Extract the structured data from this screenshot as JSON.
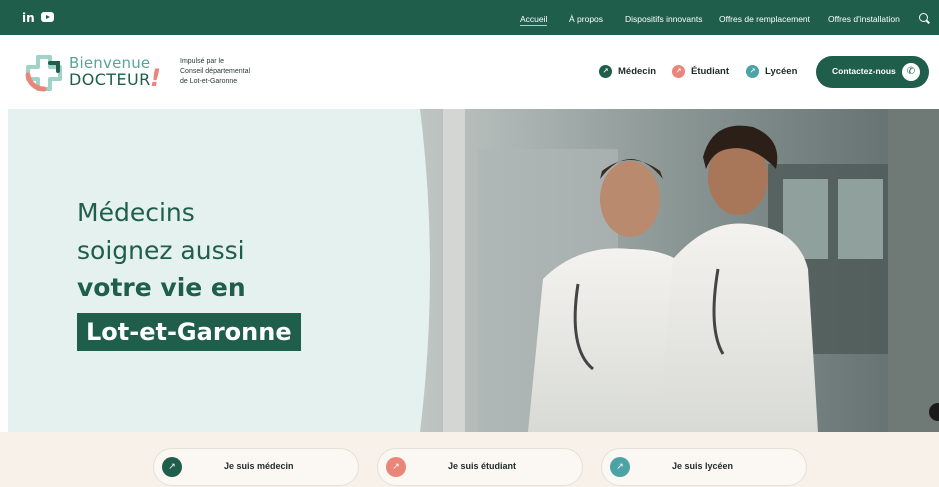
{
  "topbar": {
    "social": {
      "linkedin": "in",
      "youtube_icon": "youtube-icon"
    },
    "nav": [
      {
        "label": "Accueil",
        "active": true
      },
      {
        "label": "À propos"
      },
      {
        "label": "Dispositifs innovants"
      },
      {
        "label": "Offres de remplacement"
      },
      {
        "label": "Offres d'installation"
      }
    ],
    "search_icon": "search-icon"
  },
  "header": {
    "logo": {
      "line1": "Bienvenue",
      "line2": "DOCTEUR",
      "bang": "!"
    },
    "tagline": [
      "Impulsé par le",
      "Conseil départemental",
      "de Lot-et-Garonne"
    ],
    "audiences": [
      {
        "label": "Médecin",
        "color": "#1e5e4b"
      },
      {
        "label": "Étudiant",
        "color": "#e98579"
      },
      {
        "label": "Lycéen",
        "color": "#4ba3a6"
      }
    ],
    "contact_label": "Contactez-nous"
  },
  "hero": {
    "line1": "Médecins",
    "line2": "soignez aussi",
    "line3": "votre vie en",
    "line4": "Lot-et-Garonne"
  },
  "choices": [
    {
      "label": "Je suis médecin",
      "color": "#1e5e4b"
    },
    {
      "label": "Je suis étudiant",
      "color": "#e98579"
    },
    {
      "label": "Je suis lycéen",
      "color": "#4ba3a6"
    }
  ],
  "colors": {
    "brand": "#1e5e4b",
    "coral": "#e98579",
    "teal": "#4ba3a6",
    "hero_bg": "#e5f1ee",
    "bottom_bg": "#f8f1ea"
  }
}
